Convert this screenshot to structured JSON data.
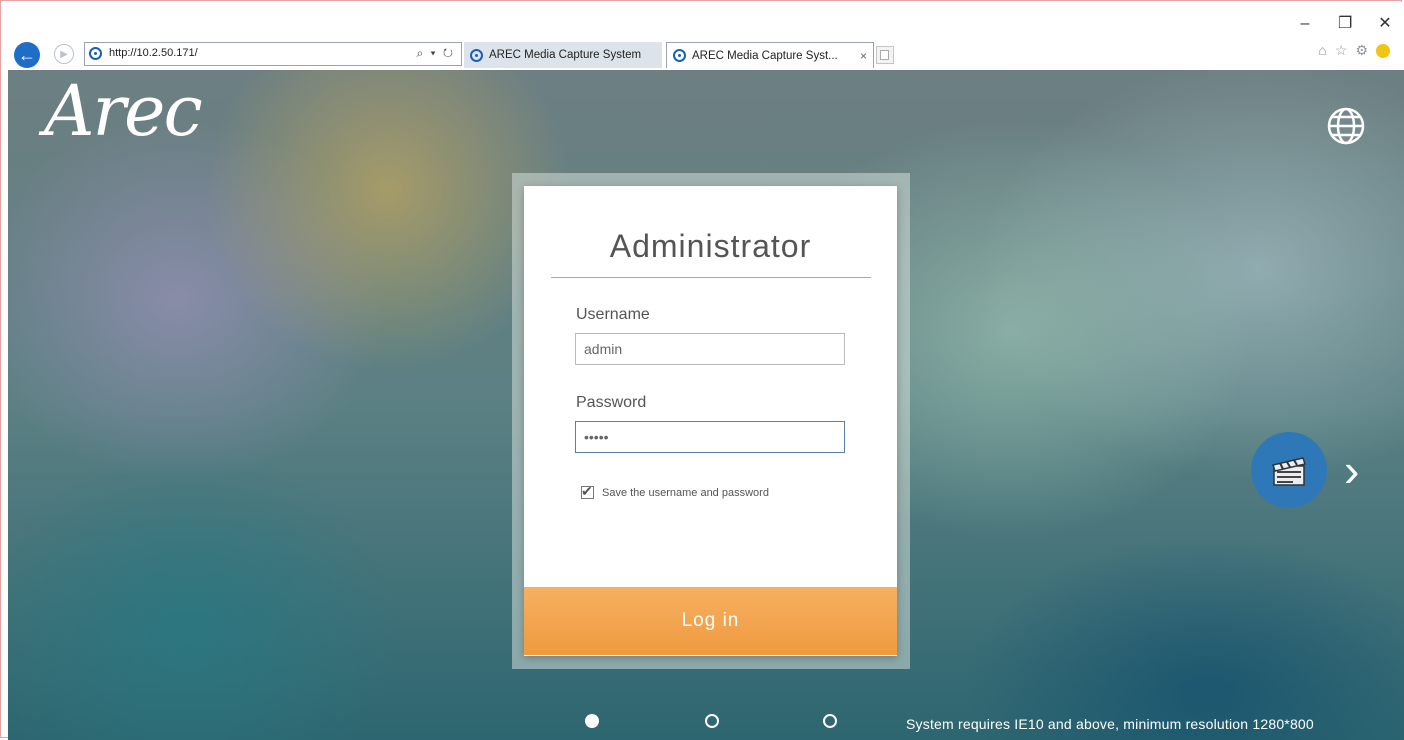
{
  "browser": {
    "address": {
      "url": "http://10.2.50.171/",
      "tools": "⌕ ▾ ↻"
    },
    "tabs": [
      {
        "label": "AREC Media Capture System"
      },
      {
        "label": "AREC Media Capture Syst...",
        "close": "×"
      }
    ],
    "window_controls": {
      "minimize": "–",
      "restore": "❐",
      "close": "✕"
    },
    "toolbar": {
      "home": "⌂",
      "favorites": "☆",
      "settings": "⚙"
    }
  },
  "page": {
    "logo": "Arec",
    "login": {
      "title": "Administrator",
      "username_label": "Username",
      "username_value": "admin",
      "password_label": "Password",
      "password_value": "•••••",
      "remember_label": "Save the username and password",
      "remember_checked": true,
      "login_button": "Log in"
    },
    "next_arrow": "›",
    "pagination": {
      "total": 3,
      "active": 1
    },
    "system_note": "System requires IE10 and above, minimum resolution 1280*800"
  },
  "colors": {
    "accent_orange": "#ef9a3e",
    "feature_blue": "#2f78b8",
    "browser_blue": "#1e6ec8"
  },
  "icons": [
    "back-arrow-icon",
    "forward-arrow-icon",
    "site-favicon-icon",
    "globe-icon",
    "clapperboard-icon",
    "chevron-right-icon",
    "checkmark-icon",
    "home-icon",
    "star-icon",
    "gear-icon",
    "smiley-icon"
  ]
}
